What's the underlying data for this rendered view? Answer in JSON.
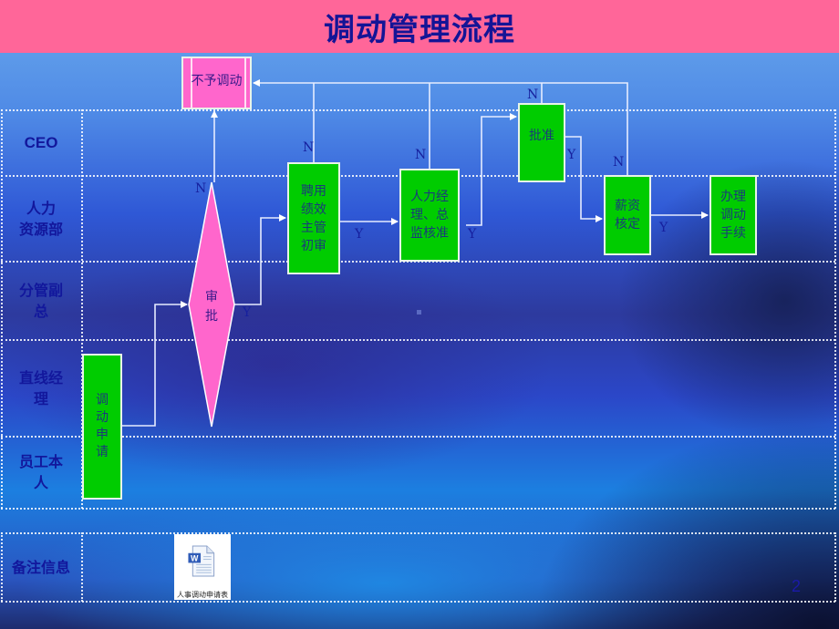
{
  "title": "调动管理流程",
  "colors": {
    "title_bar": "#ff6699",
    "title_text": "#141496",
    "process_box": "#00cc00",
    "decision": "#ff66cc",
    "lane_label": "#12179c"
  },
  "lanes": [
    {
      "label": "CEO"
    },
    {
      "label": "人力\n资源部"
    },
    {
      "label": "分管副\n总"
    },
    {
      "label": "直线经\n理"
    },
    {
      "label": "员工本\n人"
    }
  ],
  "footer_row": {
    "label": "备注信息",
    "attachment": {
      "icon": "word-document-icon",
      "caption": "人事调动申请表"
    }
  },
  "nodes": {
    "reject": "不予调动",
    "apply": "调\n动\n申\n请",
    "review_decision": "审\n批",
    "hiring_review": "聘用\n绩效\n主管\n初审",
    "hr_approval": "人力经\n理、总\n监核准",
    "ceo_approval": "批准",
    "salary_check": "薪资\n核定",
    "process_transfer": "办理\n调动\n手续"
  },
  "branch_labels": {
    "yes": "Y",
    "no": "N"
  },
  "page_number": "2"
}
